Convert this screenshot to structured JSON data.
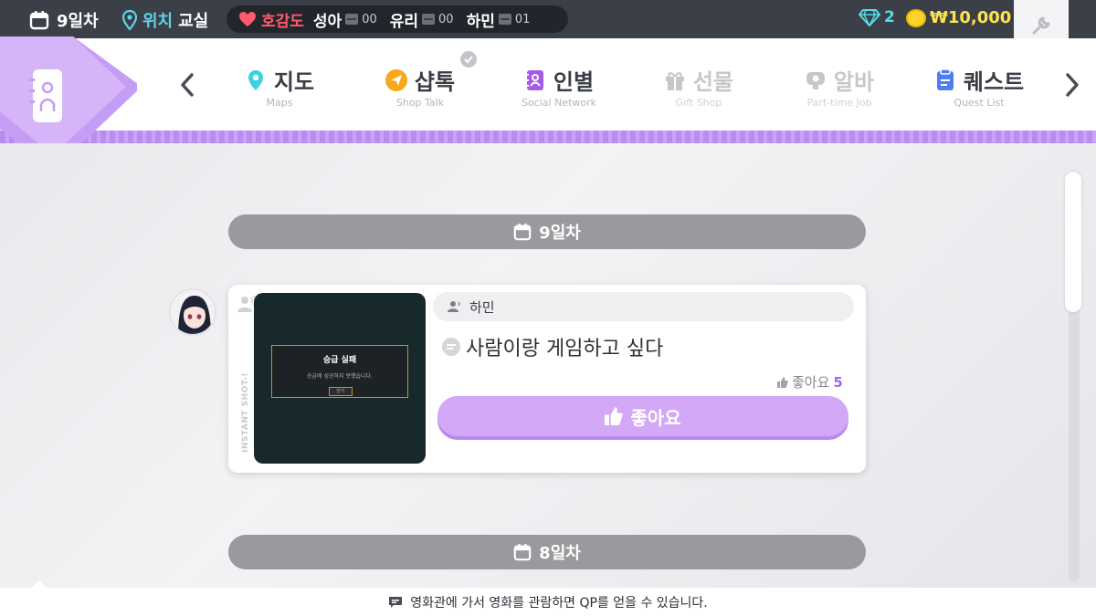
{
  "topbar": {
    "day": "9일차",
    "location_label": "위치",
    "location_value": "교실",
    "affinity_title": "호감도",
    "affinity": [
      {
        "name": "성아",
        "value": "00"
      },
      {
        "name": "유리",
        "value": "00"
      },
      {
        "name": "하민",
        "value": "01"
      }
    ],
    "gems": "2",
    "money": "₩10,000"
  },
  "nav": {
    "items": [
      {
        "label": "지도",
        "sub": "Maps",
        "icon": "map-pin-icon",
        "color": "#3ad1e0"
      },
      {
        "label": "샵톡",
        "sub": "Shop Talk",
        "icon": "paper-plane-icon",
        "color": "#f7a81b"
      },
      {
        "label": "인별",
        "sub": "Social Network",
        "icon": "social-notebook-icon",
        "color": "#a45be8"
      },
      {
        "label": "선물",
        "sub": "Gift Shop",
        "icon": "gift-icon",
        "color": "#c5c7cb"
      },
      {
        "label": "알바",
        "sub": "Part-time Job",
        "icon": "chat-headset-icon",
        "color": "#c5c7cb"
      },
      {
        "label": "퀘스트",
        "sub": "Quest List",
        "icon": "clipboard-icon",
        "color": "#4d7ff2"
      }
    ]
  },
  "feed": {
    "day_header_1": "9일차",
    "day_header_2": "8일차",
    "post": {
      "instant_label": "INSTANT SHOT-!",
      "screenshot_title": "승급 실패",
      "screenshot_sub": "승급에 성공하지 못했습니다.",
      "screenshot_button": "닫기",
      "author": "하민",
      "text": "사람이랑 게임하고 싶다",
      "like_label": "좋아요",
      "like_count": "5",
      "like_button": "좋아요"
    }
  },
  "tip": {
    "text": "영화관에 가서 영화를 관람하면 QP를 얻을 수 있습니다."
  },
  "colors": {
    "accent_purple": "#c9a3f5",
    "like_button": "#d3a8f7",
    "affinity_red": "#ff5a6e",
    "location_cyan": "#5fd4e8",
    "money_yellow": "#ffe34a"
  }
}
